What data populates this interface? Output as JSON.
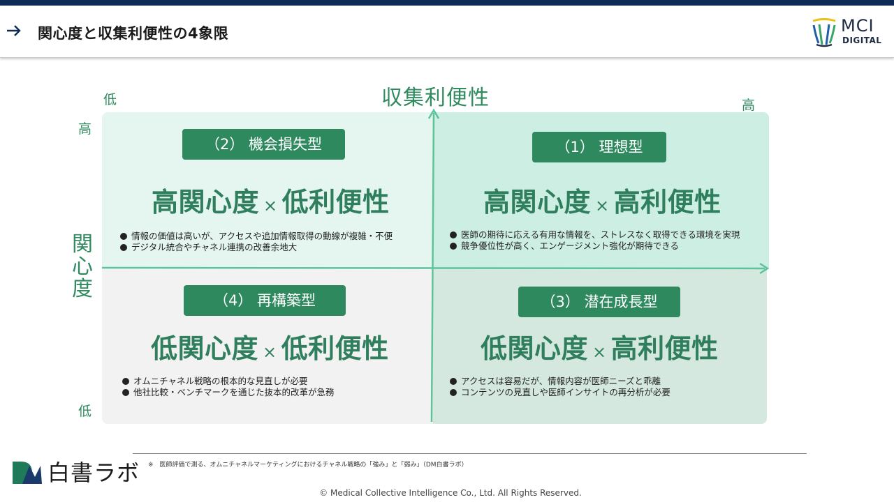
{
  "header": {
    "title": "関心度と収集利便性の4象限"
  },
  "logo": {
    "line1": "MCI",
    "line2": "DIGITAL"
  },
  "axes": {
    "x_title": "収集利便性",
    "x_low": "低",
    "x_high": "高",
    "y_title": [
      "関",
      "心",
      "度"
    ],
    "y_high": "高",
    "y_low": "低"
  },
  "quadrants": {
    "q2": {
      "badge": "（2） 機会損失型",
      "headline_left": "高関心度",
      "times": "×",
      "headline_right": "低利便性",
      "bullets": [
        "情報の価値は高いが、アクセスや追加情報取得の動線が複雑・不便",
        "デジタル統合やチャネル連携の改善余地大"
      ]
    },
    "q1": {
      "badge": "（1） 理想型",
      "headline_left": "高関心度",
      "times": "×",
      "headline_right": "高利便性",
      "bullets": [
        "医師の期待に応える有用な情報を、ストレスなく取得できる環境を実現",
        "競争優位性が高く、エンゲージメント強化が期待できる"
      ]
    },
    "q4": {
      "badge": "（4） 再構築型",
      "headline_left": "低関心度",
      "times": "×",
      "headline_right": "低利便性",
      "bullets": [
        "オムニチャネル戦略の根本的な見直しが必要",
        "他社比較・ベンチマークを通じた抜本的改革が急務"
      ]
    },
    "q3": {
      "badge": "（3） 潜在成長型",
      "headline_left": "低関心度",
      "times": "×",
      "headline_right": "高利便性",
      "bullets": [
        "アクセスは容易だが、情報内容が医師ニーズと乖離",
        "コンテンツの見直しや医師インサイトの再分析が必要"
      ]
    }
  },
  "footer": {
    "note": "※　医師評価で測る、オムニチャネルマーケティングにおけるチャネル戦略の「強み」と「弱み」（DM白書ラボ）",
    "brand": "白書ラボ",
    "copyright": "© Medical Collective Intelligence Co., Ltd. All Rights Reserved."
  },
  "colors": {
    "accent_green": "#2e8a5e",
    "axis_green": "#5cc39a",
    "navy": "#0e2a55"
  }
}
